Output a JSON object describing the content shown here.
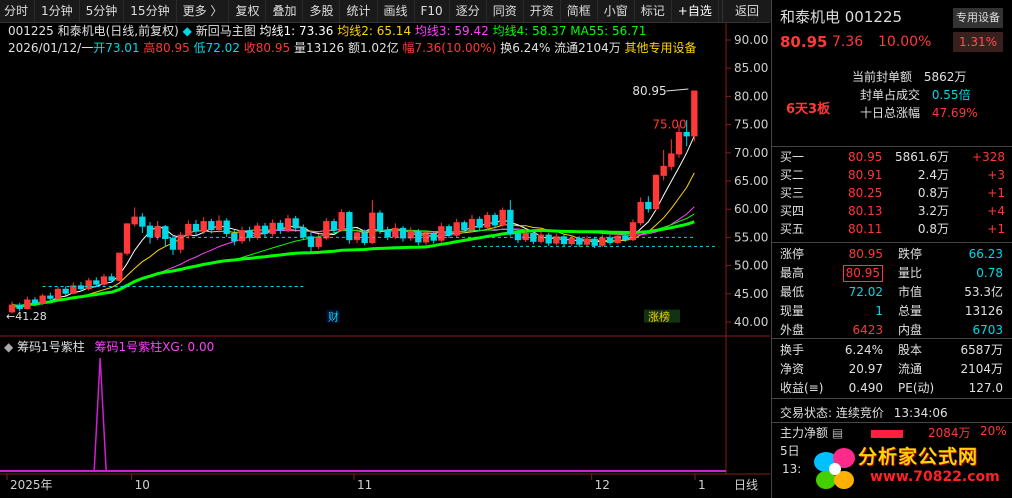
{
  "toolbar": {
    "items": [
      "分时",
      "1分钟",
      "5分钟",
      "15分钟",
      "更多",
      "复权",
      "叠加",
      "多股",
      "统计",
      "画线",
      "F10",
      "逐分",
      "同资",
      "开资",
      "简框",
      "小窗",
      "标记"
    ],
    "add": "+自选",
    "back": "返回",
    "more_arrow": "〉"
  },
  "header": {
    "code_name": "001225 和泰机电(日线,前复权)",
    "main_indicator": "新回马主图",
    "ma1": "均线1: 73.36",
    "ma2": "均线2: 65.14",
    "ma3": "均线3: 59.42",
    "ma4": "均线4: 58.37",
    "ma55": "MA55: 56.71",
    "line2_date": "2026/01/12/一",
    "open": "开73.01",
    "high": "高80.95",
    "low": "低72.02",
    "close": "收80.95",
    "vol": "量13126",
    "amount": "额1.02亿",
    "range": "幅7.36(10.00%)",
    "turnover": "换6.24%",
    "float": "流通2104万",
    "other": "其他专用设备"
  },
  "sub": {
    "name": "筹码1号紫柱",
    "xg": "筹码1号紫柱XG: 0.00"
  },
  "colors": {
    "up": "#ff3838",
    "down": "#00d8e8",
    "ma1": "#ffffff",
    "ma2": "#ffd400",
    "ma3": "#ff40ff",
    "ma4": "#00ff00",
    "ma55": "#00ff00",
    "purple": "#d020d0"
  },
  "chart_data": {
    "type": "candlestick",
    "y_axis_ticks": [
      90,
      85,
      80,
      75,
      70,
      65,
      60,
      55,
      50,
      45,
      40
    ],
    "x_axis_labels": [
      "2025年",
      "10",
      "11",
      "12",
      "1"
    ],
    "axis_corner": "日线",
    "price_labels": {
      "high_label": "80.95",
      "low_label": "41.28",
      "mid_label": "75.00"
    },
    "markers": {
      "cai": "财",
      "longhu": "涨榜"
    },
    "candles": [
      {
        "o": 41.8,
        "c": 43.0,
        "h": 43.6,
        "l": 41.5
      },
      {
        "o": 43.0,
        "c": 42.4,
        "h": 43.4,
        "l": 41.9
      },
      {
        "o": 42.4,
        "c": 43.9,
        "h": 44.5,
        "l": 42.2
      },
      {
        "o": 43.9,
        "c": 43.3,
        "h": 44.4,
        "l": 42.8
      },
      {
        "o": 43.3,
        "c": 44.6,
        "h": 45.0,
        "l": 43.0
      },
      {
        "o": 44.6,
        "c": 44.2,
        "h": 45.2,
        "l": 43.7
      },
      {
        "o": 44.2,
        "c": 45.8,
        "h": 46.2,
        "l": 44.0
      },
      {
        "o": 45.8,
        "c": 45.1,
        "h": 46.3,
        "l": 44.7
      },
      {
        "o": 45.1,
        "c": 46.4,
        "h": 47.0,
        "l": 44.9
      },
      {
        "o": 46.4,
        "c": 45.9,
        "h": 47.1,
        "l": 45.4
      },
      {
        "o": 45.9,
        "c": 47.3,
        "h": 47.8,
        "l": 45.6
      },
      {
        "o": 47.3,
        "c": 46.7,
        "h": 47.9,
        "l": 46.2
      },
      {
        "o": 46.7,
        "c": 48.0,
        "h": 48.5,
        "l": 46.4
      },
      {
        "o": 48.0,
        "c": 47.4,
        "h": 48.6,
        "l": 47.0
      },
      {
        "o": 47.4,
        "c": 52.2,
        "h": 52.2,
        "l": 47.2
      },
      {
        "o": 52.2,
        "c": 57.4,
        "h": 57.4,
        "l": 51.8
      },
      {
        "o": 57.4,
        "c": 58.6,
        "h": 60.3,
        "l": 56.9
      },
      {
        "o": 58.6,
        "c": 57.0,
        "h": 59.3,
        "l": 55.8
      },
      {
        "o": 57.0,
        "c": 55.1,
        "h": 57.7,
        "l": 53.9
      },
      {
        "o": 55.1,
        "c": 56.9,
        "h": 57.9,
        "l": 54.5
      },
      {
        "o": 56.9,
        "c": 54.8,
        "h": 57.2,
        "l": 53.4
      },
      {
        "o": 54.8,
        "c": 52.9,
        "h": 55.4,
        "l": 51.9
      },
      {
        "o": 52.9,
        "c": 55.4,
        "h": 56.0,
        "l": 52.2
      },
      {
        "o": 55.4,
        "c": 57.3,
        "h": 58.0,
        "l": 54.8
      },
      {
        "o": 57.3,
        "c": 56.1,
        "h": 58.1,
        "l": 55.3
      },
      {
        "o": 56.1,
        "c": 57.8,
        "h": 58.6,
        "l": 55.6
      },
      {
        "o": 57.8,
        "c": 56.4,
        "h": 58.3,
        "l": 55.7
      },
      {
        "o": 56.4,
        "c": 57.9,
        "h": 58.9,
        "l": 55.9
      },
      {
        "o": 57.9,
        "c": 55.7,
        "h": 58.4,
        "l": 55.1
      },
      {
        "o": 55.7,
        "c": 54.4,
        "h": 56.4,
        "l": 53.6
      },
      {
        "o": 54.4,
        "c": 56.2,
        "h": 56.9,
        "l": 53.9
      },
      {
        "o": 56.2,
        "c": 55.0,
        "h": 56.9,
        "l": 54.3
      },
      {
        "o": 55.0,
        "c": 57.0,
        "h": 57.6,
        "l": 54.6
      },
      {
        "o": 57.0,
        "c": 55.7,
        "h": 57.6,
        "l": 55.0
      },
      {
        "o": 55.7,
        "c": 57.5,
        "h": 58.2,
        "l": 55.2
      },
      {
        "o": 57.5,
        "c": 56.3,
        "h": 58.1,
        "l": 55.6
      },
      {
        "o": 56.3,
        "c": 58.3,
        "h": 59.0,
        "l": 55.9
      },
      {
        "o": 58.3,
        "c": 56.7,
        "h": 58.8,
        "l": 56.0
      },
      {
        "o": 56.7,
        "c": 55.1,
        "h": 57.3,
        "l": 54.5
      },
      {
        "o": 55.1,
        "c": 53.4,
        "h": 55.8,
        "l": 52.5
      },
      {
        "o": 53.4,
        "c": 54.9,
        "h": 55.6,
        "l": 52.9
      },
      {
        "o": 54.9,
        "c": 57.8,
        "h": 58.4,
        "l": 54.6
      },
      {
        "o": 57.8,
        "c": 56.3,
        "h": 58.3,
        "l": 55.7
      },
      {
        "o": 56.3,
        "c": 59.4,
        "h": 60.0,
        "l": 56.1
      },
      {
        "o": 59.4,
        "c": 54.6,
        "h": 59.7,
        "l": 53.9
      },
      {
        "o": 54.6,
        "c": 55.8,
        "h": 56.6,
        "l": 54.0
      },
      {
        "o": 55.8,
        "c": 54.1,
        "h": 56.4,
        "l": 53.6
      },
      {
        "o": 54.1,
        "c": 59.3,
        "h": 61.6,
        "l": 53.8
      },
      {
        "o": 59.3,
        "c": 56.3,
        "h": 59.8,
        "l": 55.6
      },
      {
        "o": 56.3,
        "c": 55.1,
        "h": 56.9,
        "l": 54.5
      },
      {
        "o": 55.1,
        "c": 56.6,
        "h": 57.5,
        "l": 54.7
      },
      {
        "o": 56.6,
        "c": 54.9,
        "h": 57.0,
        "l": 54.2
      },
      {
        "o": 54.9,
        "c": 56.1,
        "h": 56.8,
        "l": 54.4
      },
      {
        "o": 56.1,
        "c": 54.2,
        "h": 56.5,
        "l": 53.6
      },
      {
        "o": 54.2,
        "c": 55.6,
        "h": 56.2,
        "l": 53.7
      },
      {
        "o": 55.6,
        "c": 54.5,
        "h": 56.1,
        "l": 53.9
      },
      {
        "o": 54.5,
        "c": 56.9,
        "h": 57.6,
        "l": 54.1
      },
      {
        "o": 56.9,
        "c": 55.4,
        "h": 57.3,
        "l": 54.9
      },
      {
        "o": 55.4,
        "c": 57.6,
        "h": 58.3,
        "l": 55.0
      },
      {
        "o": 57.6,
        "c": 56.4,
        "h": 58.0,
        "l": 55.8
      },
      {
        "o": 56.4,
        "c": 58.2,
        "h": 59.0,
        "l": 56.0
      },
      {
        "o": 58.2,
        "c": 56.8,
        "h": 58.7,
        "l": 56.1
      },
      {
        "o": 56.8,
        "c": 58.9,
        "h": 59.5,
        "l": 56.4
      },
      {
        "o": 58.9,
        "c": 57.2,
        "h": 59.4,
        "l": 56.6
      },
      {
        "o": 57.2,
        "c": 59.8,
        "h": 60.3,
        "l": 56.9
      },
      {
        "o": 59.8,
        "c": 55.6,
        "h": 61.6,
        "l": 55.2
      },
      {
        "o": 55.6,
        "c": 54.6,
        "h": 56.3,
        "l": 54.0
      },
      {
        "o": 54.6,
        "c": 55.7,
        "h": 56.3,
        "l": 54.2
      },
      {
        "o": 55.7,
        "c": 54.3,
        "h": 56.1,
        "l": 53.8
      },
      {
        "o": 54.3,
        "c": 55.4,
        "h": 56.0,
        "l": 53.9
      },
      {
        "o": 55.4,
        "c": 54.0,
        "h": 55.8,
        "l": 53.5
      },
      {
        "o": 54.0,
        "c": 55.1,
        "h": 55.7,
        "l": 53.6
      },
      {
        "o": 55.1,
        "c": 53.9,
        "h": 55.5,
        "l": 53.4
      },
      {
        "o": 53.9,
        "c": 54.8,
        "h": 55.4,
        "l": 53.5
      },
      {
        "o": 54.8,
        "c": 53.8,
        "h": 55.2,
        "l": 53.3
      },
      {
        "o": 53.8,
        "c": 54.7,
        "h": 55.3,
        "l": 53.4
      },
      {
        "o": 54.7,
        "c": 53.6,
        "h": 55.1,
        "l": 53.1
      },
      {
        "o": 53.6,
        "c": 54.9,
        "h": 55.5,
        "l": 53.3
      },
      {
        "o": 54.9,
        "c": 54.1,
        "h": 55.4,
        "l": 53.6
      },
      {
        "o": 54.1,
        "c": 55.2,
        "h": 55.8,
        "l": 53.8
      },
      {
        "o": 55.2,
        "c": 54.6,
        "h": 55.9,
        "l": 54.2
      },
      {
        "o": 54.6,
        "c": 57.6,
        "h": 58.2,
        "l": 54.3
      },
      {
        "o": 57.6,
        "c": 61.2,
        "h": 62.1,
        "l": 57.1
      },
      {
        "o": 61.2,
        "c": 60.1,
        "h": 62.3,
        "l": 59.4
      },
      {
        "o": 60.1,
        "c": 66.0,
        "h": 66.2,
        "l": 59.8
      },
      {
        "o": 66.0,
        "c": 67.6,
        "h": 70.5,
        "l": 65.1
      },
      {
        "o": 67.6,
        "c": 69.8,
        "h": 72.4,
        "l": 66.9
      },
      {
        "o": 69.8,
        "c": 73.6,
        "h": 74.9,
        "l": 69.1
      },
      {
        "o": 73.6,
        "c": 73.0,
        "h": 75.8,
        "l": 71.2
      },
      {
        "o": 73.0,
        "c": 80.95,
        "h": 80.95,
        "l": 72.0
      }
    ],
    "sub_series": {
      "name": "筹码1号紫柱",
      "spike_index": 11,
      "ylim": [
        0,
        1
      ]
    }
  },
  "sidebar": {
    "name_code": "和泰机电 001225",
    "dedicated": "专用设备",
    "price": "80.95",
    "chg": "7.36",
    "pct": "10.00%",
    "box": "1.31%",
    "seal_label": "当前封单额",
    "seal_value": "5862万",
    "seal_ratio_label": "封单占成交",
    "seal_ratio_value": "0.55倍",
    "board": "6天3板",
    "ten_day_label": "十日总涨幅",
    "ten_day_value": "47.69%",
    "orderbook": [
      {
        "label": "买一",
        "price": "80.95",
        "vol": "5861.6万",
        "chg": "+328"
      },
      {
        "label": "买二",
        "price": "80.91",
        "vol": "2.4万",
        "chg": "+3"
      },
      {
        "label": "买三",
        "price": "80.25",
        "vol": "0.8万",
        "chg": "+1"
      },
      {
        "label": "买四",
        "price": "80.13",
        "vol": "3.2万",
        "chg": "+4"
      },
      {
        "label": "买五",
        "price": "80.11",
        "vol": "0.8万",
        "chg": "+1"
      }
    ],
    "quote1": [
      {
        "l1": "涨停",
        "v1": "80.95",
        "c1": "red",
        "l2": "跌停",
        "v2": "66.23",
        "c2": "cyan"
      },
      {
        "l1": "最高",
        "v1": "80.95",
        "c1": "red",
        "l2": "量比",
        "v2": "0.78",
        "c2": "cyan"
      },
      {
        "l1": "最低",
        "v1": "72.02",
        "c1": "cyan",
        "l2": "市值",
        "v2": "53.3亿",
        "c2": "white"
      },
      {
        "l1": "现量",
        "v1": "1",
        "c1": "cyan",
        "l2": "总量",
        "v2": "13126",
        "c2": "white"
      },
      {
        "l1": "外盘",
        "v1": "6423",
        "c1": "red",
        "l2": "内盘",
        "v2": "6703",
        "c2": "cyan"
      }
    ],
    "quote2": [
      {
        "l1": "换手",
        "v1": "6.24%",
        "l2": "股本",
        "v2": "6587万"
      },
      {
        "l1": "净资",
        "v1": "20.97",
        "l2": "流通",
        "v2": "2104万"
      },
      {
        "l1": "收益(≡)",
        "v1": "0.490",
        "l2": "PE(动)",
        "v2": "127.0"
      }
    ],
    "trade_state_label": "交易状态:",
    "trade_state_value": "连续竞价",
    "trade_time": "13:34:06",
    "net_label": "主力净额",
    "net_value": "2084万",
    "net_pct": "20%",
    "day_label": "5日",
    "time_label": "13:"
  },
  "watermark": {
    "name": "分析家公式网",
    "url": "www.70822.com"
  }
}
